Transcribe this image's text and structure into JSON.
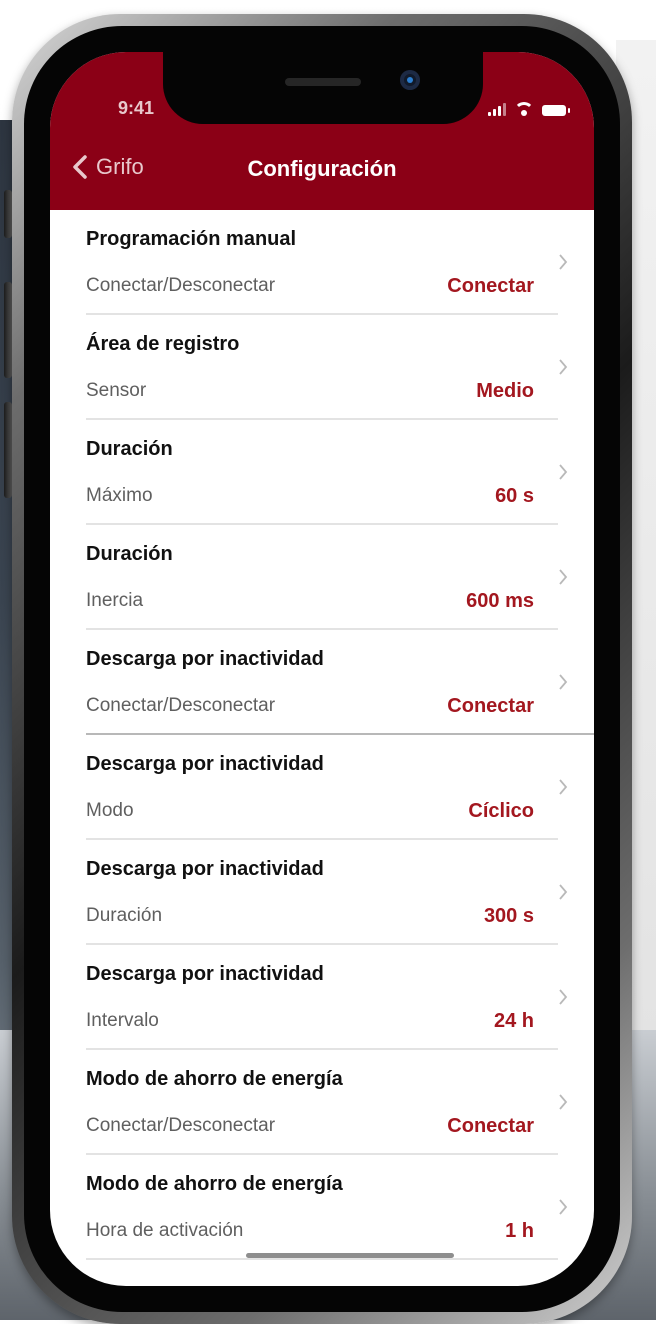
{
  "status_bar": {
    "time": "9:41"
  },
  "nav": {
    "back_label": "Grifo",
    "title": "Configuración"
  },
  "colors": {
    "header": "#8b0016",
    "value": "#a3171f"
  },
  "rows": [
    {
      "title": "Programación manual",
      "label": "Conectar/Desconectar",
      "value": "Conectar"
    },
    {
      "title": "Área de registro",
      "label": "Sensor",
      "value": "Medio"
    },
    {
      "title": "Duración",
      "label": "Máximo",
      "value": "60 s"
    },
    {
      "title": "Duración",
      "label": "Inercia",
      "value": "600 ms"
    },
    {
      "title": "Descarga por inactividad",
      "label": "Conectar/Desconectar",
      "value": "Conectar"
    },
    {
      "title": "Descarga por inactividad",
      "label": "Modo",
      "value": "Cíclico"
    },
    {
      "title": "Descarga por inactividad",
      "label": "Duración",
      "value": "300 s"
    },
    {
      "title": "Descarga por inactividad",
      "label": "Intervalo",
      "value": "24 h"
    },
    {
      "title": "Modo de ahorro de energía",
      "label": "Conectar/Desconectar",
      "value": "Conectar"
    },
    {
      "title": "Modo de ahorro de energía",
      "label": "Hora de activación",
      "value": "1 h"
    }
  ]
}
